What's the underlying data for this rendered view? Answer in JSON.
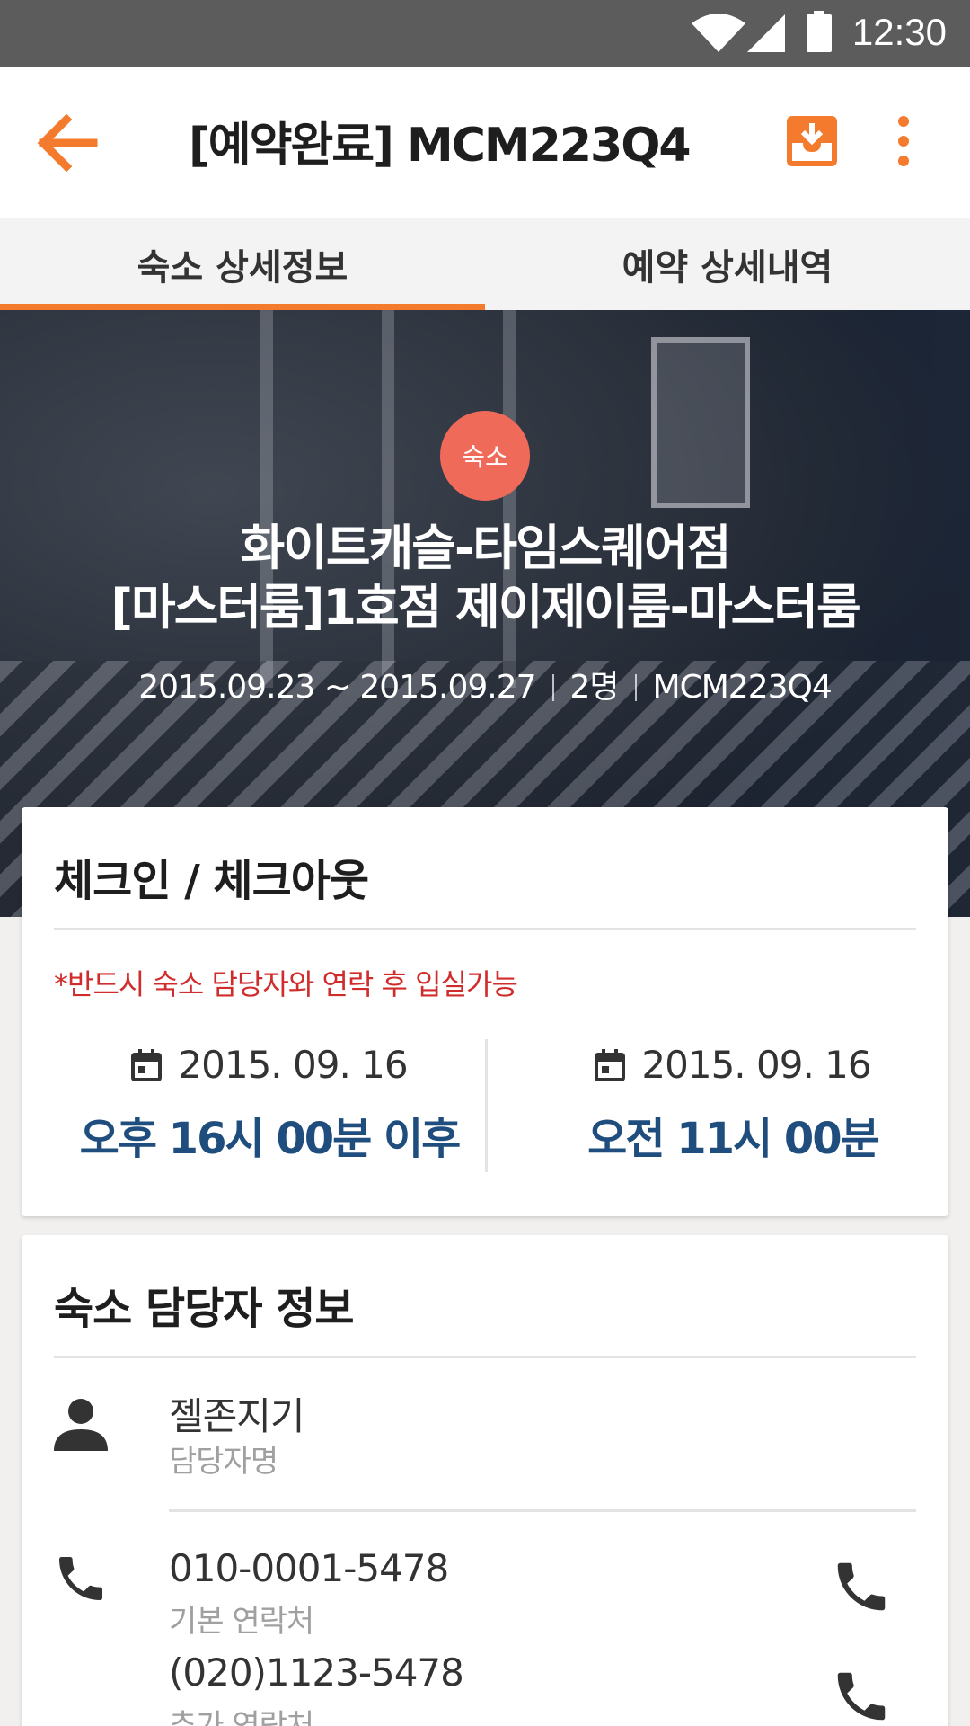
{
  "status_bar": {
    "time": "12:30"
  },
  "app_bar": {
    "title": "[예약완료] MCM223Q4",
    "accent_color": "#f47a2e",
    "icons": [
      "arrow-back-icon",
      "download-icon",
      "more-vert-icon"
    ]
  },
  "tabs": [
    {
      "label": "숙소 상세정보",
      "active": true
    },
    {
      "label": "예약 상세내역",
      "active": false
    }
  ],
  "hero": {
    "badge": "숙소",
    "name_line1": "화이트캐슬-타임스퀘어점",
    "name_line2": "[마스터룸]1호점 제이제이룸-마스터룸",
    "dates": "2015.09.23 ~ 2015.09.27",
    "guests": "2명",
    "code": "MCM223Q4"
  },
  "checkin_card": {
    "title": "체크인 / 체크아웃",
    "notice": "*반드시 숙소 담당자와 연락 후 입실가능",
    "checkin": {
      "date": "2015. 09. 16",
      "time": "오후 16시 00분 이후"
    },
    "checkout": {
      "date": "2015. 09. 16",
      "time": "오전 11시 00분"
    }
  },
  "manager_card": {
    "title": "숙소 담당자 정보",
    "name": "젤존지기",
    "name_label": "담당자명",
    "phone1": "010-0001-5478",
    "phone1_label": "기본 연락처",
    "phone2": "(020)1123-5478",
    "phone2_label": "추가 연락처"
  }
}
